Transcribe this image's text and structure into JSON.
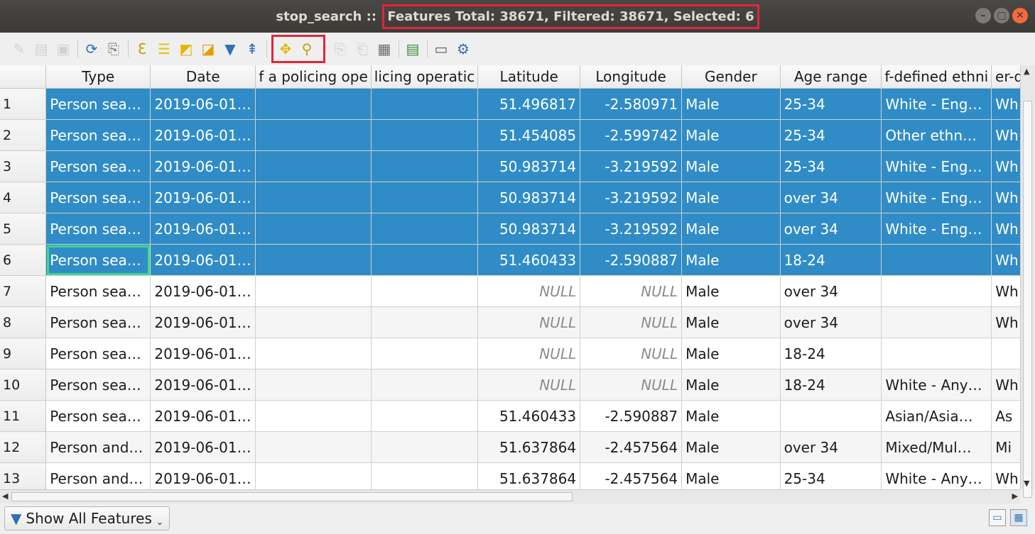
{
  "window": {
    "title_prefix": "stop_search :: ",
    "title_stats": "Features Total: 38671, Filtered: 38671, Selected: 6",
    "buttons": [
      "–",
      "▢",
      "✕"
    ]
  },
  "toolbar": {
    "icons": [
      {
        "name": "toggle-editing-icon",
        "glyph": "✎",
        "color": "#9a9a9a",
        "disabled": true
      },
      {
        "name": "multi-edit-icon",
        "glyph": "▤",
        "color": "#9a9a9a",
        "disabled": true
      },
      {
        "name": "save-edits-icon",
        "glyph": "▣",
        "color": "#9a9a9a",
        "disabled": true
      },
      {
        "name": "reload-icon",
        "glyph": "⟳",
        "color": "#2b6cc4",
        "disabled": false
      },
      {
        "name": "add-feature-icon",
        "glyph": "⎘",
        "color": "#7a7a7a",
        "disabled": false
      },
      {
        "name": "select-by-expression-icon",
        "glyph": "Ɛ",
        "color": "#c99a00",
        "disabled": false
      },
      {
        "name": "select-all-icon",
        "glyph": "☰",
        "color": "#e8c200",
        "disabled": false
      },
      {
        "name": "invert-selection-icon",
        "glyph": "◩",
        "color": "#e0b800",
        "disabled": false
      },
      {
        "name": "deselect-all-icon",
        "glyph": "◪",
        "color": "#e0a000",
        "disabled": false
      },
      {
        "name": "filter-select-icon",
        "glyph": "▼",
        "color": "#2f6fb5",
        "disabled": false
      },
      {
        "name": "move-selection-top-icon",
        "glyph": "⇞",
        "color": "#2f6fb5",
        "disabled": false
      }
    ],
    "highlighted_icons": [
      {
        "name": "pan-to-selection-icon",
        "glyph": "✥",
        "color": "#e0b800"
      },
      {
        "name": "zoom-to-selection-icon",
        "glyph": "⚲",
        "color": "#c8a000"
      }
    ],
    "icons_after": [
      {
        "name": "copy-icon",
        "glyph": "⎘",
        "color": "#9a9a9a",
        "disabled": true
      },
      {
        "name": "paste-icon",
        "glyph": "⎗",
        "color": "#9a9a9a",
        "disabled": true
      },
      {
        "name": "field-calculator-icon",
        "glyph": "▦",
        "color": "#6a6a6a",
        "disabled": false
      },
      {
        "name": "conditional-formatting-icon",
        "glyph": "▤",
        "color": "#3a8a3a",
        "disabled": false
      },
      {
        "name": "dock-table-icon",
        "glyph": "▭",
        "color": "#5a5a5a",
        "disabled": false
      },
      {
        "name": "actions-icon",
        "glyph": "⚙",
        "color": "#3a6fa8",
        "disabled": false
      }
    ]
  },
  "table": {
    "headers": [
      "Type",
      "Date",
      "Part of a policing operation",
      "Policing operation",
      "Latitude",
      "Longitude",
      "Gender",
      "Age range",
      "Self-defined ethnicity",
      "Officer-defined ethnicity"
    ],
    "header_display": [
      "Type",
      "Date",
      "f a policing ope",
      "licing operatic",
      "Latitude",
      "Longitude",
      "Gender",
      "Age range",
      "f-defined ethni",
      "er-d"
    ],
    "rows": [
      {
        "n": "1",
        "type": "Person sea…",
        "date": "2019-06-01…",
        "lat": "51.496817",
        "lon": "-2.580971",
        "gender": "Male",
        "age": "25-34",
        "ethn": "White - Eng…",
        "off": "Wh",
        "selected": true
      },
      {
        "n": "2",
        "type": "Person sea…",
        "date": "2019-06-01…",
        "lat": "51.454085",
        "lon": "-2.599742",
        "gender": "Male",
        "age": "25-34",
        "ethn": "Other ethn…",
        "off": "Wh",
        "selected": true
      },
      {
        "n": "3",
        "type": "Person sea…",
        "date": "2019-06-01…",
        "lat": "50.983714",
        "lon": "-3.219592",
        "gender": "Male",
        "age": "25-34",
        "ethn": "White - Eng…",
        "off": "Wh",
        "selected": true
      },
      {
        "n": "4",
        "type": "Person sea…",
        "date": "2019-06-01…",
        "lat": "50.983714",
        "lon": "-3.219592",
        "gender": "Male",
        "age": "over 34",
        "ethn": "White - Eng…",
        "off": "Wh",
        "selected": true
      },
      {
        "n": "5",
        "type": "Person sea…",
        "date": "2019-06-01…",
        "lat": "50.983714",
        "lon": "-3.219592",
        "gender": "Male",
        "age": "over 34",
        "ethn": "White - Eng…",
        "off": "Wh",
        "selected": true
      },
      {
        "n": "6",
        "type": "Person sea…",
        "date": "2019-06-01…",
        "lat": "51.460433",
        "lon": "-2.590887",
        "gender": "Male",
        "age": "18-24",
        "ethn": "",
        "off": "Wh",
        "selected": true
      },
      {
        "n": "7",
        "type": "Person sea…",
        "date": "2019-06-01…",
        "lat": "NULL",
        "lon": "NULL",
        "gender": "Male",
        "age": "over 34",
        "ethn": "",
        "off": "Wh",
        "selected": false
      },
      {
        "n": "8",
        "type": "Person sea…",
        "date": "2019-06-01…",
        "lat": "NULL",
        "lon": "NULL",
        "gender": "Male",
        "age": "over 34",
        "ethn": "",
        "off": "Wh",
        "selected": false
      },
      {
        "n": "9",
        "type": "Person sea…",
        "date": "2019-06-01…",
        "lat": "NULL",
        "lon": "NULL",
        "gender": "Male",
        "age": "18-24",
        "ethn": "",
        "off": "",
        "selected": false
      },
      {
        "n": "10",
        "type": "Person sea…",
        "date": "2019-06-01…",
        "lat": "NULL",
        "lon": "NULL",
        "gender": "Male",
        "age": "18-24",
        "ethn": "White - Any…",
        "off": "Wh",
        "selected": false
      },
      {
        "n": "11",
        "type": "Person sea…",
        "date": "2019-06-01…",
        "lat": "51.460433",
        "lon": "-2.590887",
        "gender": "Male",
        "age": "",
        "ethn": "Asian/Asia…",
        "off": "As",
        "selected": false
      },
      {
        "n": "12",
        "type": "Person and…",
        "date": "2019-06-01…",
        "lat": "51.637864",
        "lon": "-2.457564",
        "gender": "Male",
        "age": "over 34",
        "ethn": "Mixed/Mul…",
        "off": "Mi",
        "selected": false
      },
      {
        "n": "13",
        "type": "Person and…",
        "date": "2019-06-01…",
        "lat": "51.637864",
        "lon": "-2.457564",
        "gender": "Male",
        "age": "25-34",
        "ethn": "White - Any…",
        "off": "Wh",
        "selected": false
      }
    ],
    "current_row": 6
  },
  "bottom": {
    "filter_button_label": "Show All Features",
    "form_view_label": "Form view",
    "table_view_label": "Table view"
  },
  "colors": {
    "selection": "#308cc6",
    "current_cell_outline": "#3dd68c",
    "highlight_box": "#e0263a"
  }
}
